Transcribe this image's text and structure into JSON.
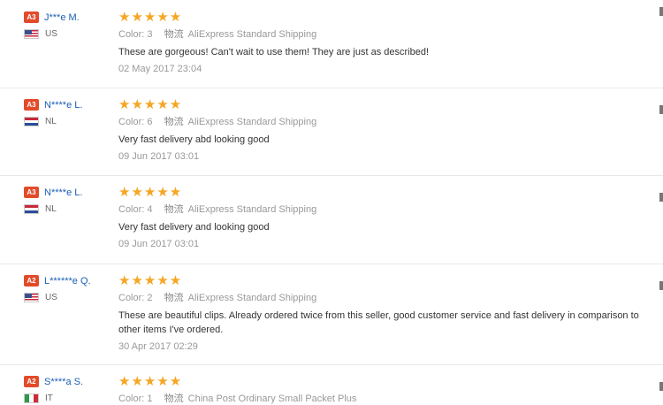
{
  "colors": {
    "star": "#f5a623",
    "name": "#1a5fb4",
    "level_badge": "#e24b2a"
  },
  "reviews": [
    {
      "level": "A3",
      "name": "J***e M.",
      "country": "US",
      "flag": "us-flag-icon",
      "stars": "★★★★★",
      "color_label": "Color:",
      "color_value": "3",
      "ship_icon": "物流",
      "shipping": "AliExpress Standard Shipping",
      "text": "These are gorgeous! Can't wait to use them! They are just as described!",
      "date": "02 May 2017 23:04"
    },
    {
      "level": "A3",
      "name": "N****e L.",
      "country": "NL",
      "flag": "nl-flag-icon",
      "stars": "★★★★★",
      "color_label": "Color:",
      "color_value": "6",
      "ship_icon": "物流",
      "shipping": "AliExpress Standard Shipping",
      "text": "Very fast delivery abd looking good",
      "date": "09 Jun 2017 03:01"
    },
    {
      "level": "A3",
      "name": "N****e L.",
      "country": "NL",
      "flag": "nl-flag-icon",
      "stars": "★★★★★",
      "color_label": "Color:",
      "color_value": "4",
      "ship_icon": "物流",
      "shipping": "AliExpress Standard Shipping",
      "text": "Very fast delivery and looking good",
      "date": "09 Jun 2017 03:01"
    },
    {
      "level": "A2",
      "name": "L******e Q.",
      "country": "US",
      "flag": "us-flag-icon",
      "stars": "★★★★★",
      "color_label": "Color:",
      "color_value": "2",
      "ship_icon": "物流",
      "shipping": "AliExpress Standard Shipping",
      "text": "These are beautiful clips. Already ordered twice from this seller, good customer service and fast delivery in comparison to",
      "text2": "other items I've ordered.",
      "date": "30 Apr 2017 02:29"
    },
    {
      "level": "A2",
      "name": "S****a S.",
      "country": "IT",
      "flag": "it-flag-icon",
      "stars": "★★★★★",
      "color_label": "Color:",
      "color_value": "1",
      "ship_icon": "物流",
      "shipping": "China Post Ordinary Small Packet Plus"
    }
  ]
}
